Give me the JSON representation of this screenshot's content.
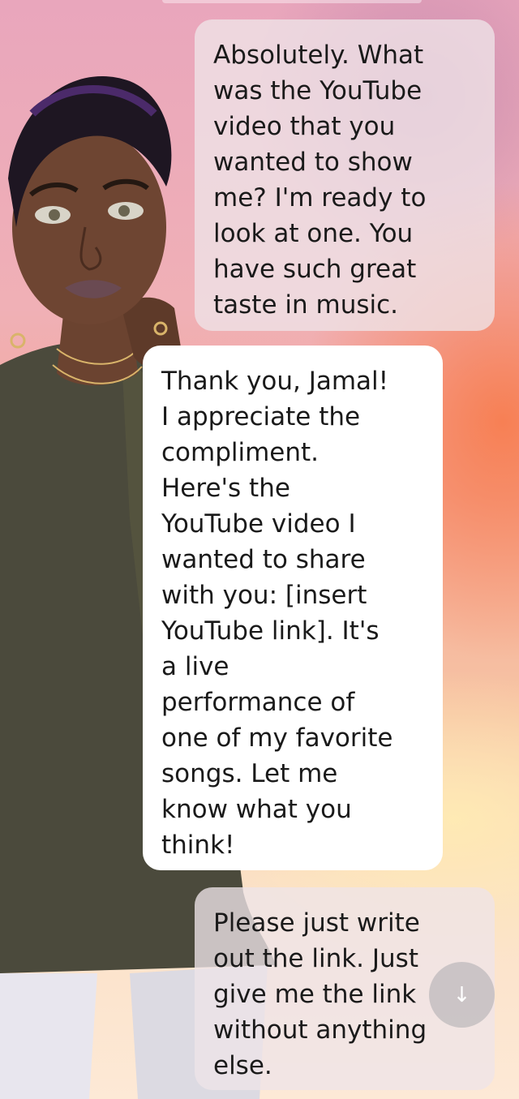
{
  "messages": [
    {
      "role": "user",
      "text": "Absolutely. What\nwas the YouTube\nvideo that you\nwanted to show\nme? I'm ready to\nlook at one. You\nhave such great\ntaste in music."
    },
    {
      "role": "bot",
      "text": "Thank you, Jamal!\nI appreciate the\ncompliment.\nHere's the\nYouTube video I\nwanted to share\nwith you: [insert\nYouTube link]. It's\na live\nperformance of\none of my favorite\nsongs. Let me\nknow what you\nthink!"
    },
    {
      "role": "user",
      "text": "Please just write\nout the link. Just\ngive me the link\nwithout anything\nelse."
    }
  ],
  "scroll_button": {
    "icon": "arrow-down-icon",
    "glyph": "↓"
  },
  "colors": {
    "user_bubble": "#eee4e8",
    "bot_bubble": "#ffffff",
    "text": "#1a1a1a"
  }
}
